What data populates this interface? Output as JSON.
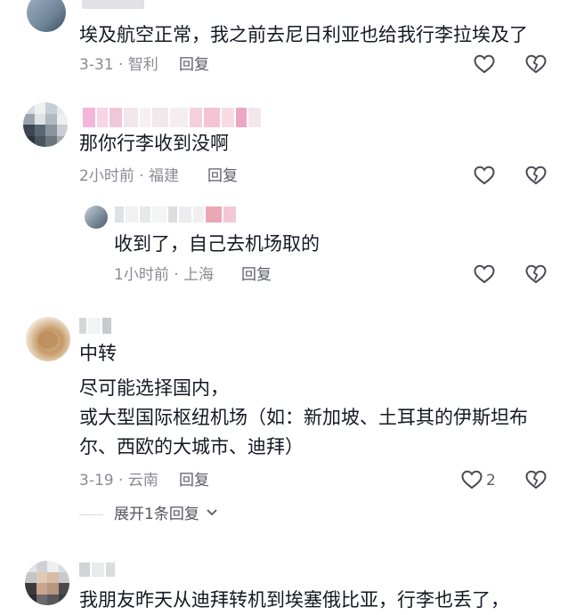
{
  "comments": [
    {
      "text": [
        "埃及航空正常，我之前去尼日利亚也给我行李拉埃及了"
      ],
      "date": "3-31",
      "location": "智利",
      "reply_label": "回复",
      "like_icon": "heart-outline-icon",
      "dislike_icon": "broken-heart-icon"
    },
    {
      "text": [
        "那你行李收到没啊"
      ],
      "date": "2小时前",
      "location": "福建",
      "reply_label": "回复",
      "like_icon": "heart-outline-icon",
      "dislike_icon": "broken-heart-icon"
    },
    {
      "text": [
        "收到了，自己去机场取的"
      ],
      "date": "1小时前",
      "location": "上海",
      "reply_label": "回复",
      "like_icon": "heart-outline-icon",
      "dislike_icon": "broken-heart-icon"
    },
    {
      "text": [
        "中转",
        "尽可能选择国内，",
        "或大型国际枢纽机场（如：新加坡、土耳其的伊斯坦布",
        "尔、西欧的大城市、迪拜）"
      ],
      "date": "3-19",
      "location": "云南",
      "reply_label": "回复",
      "like_count": "2",
      "like_icon": "heart-outline-icon",
      "dislike_icon": "broken-heart-icon",
      "expand_label": "展开1条回复",
      "expand_icon": "chevron-down-icon"
    },
    {
      "text": [
        "我朋友昨天从迪拜转机到埃塞俄比亚，行李也丢了，"
      ]
    }
  ],
  "separator": "·"
}
